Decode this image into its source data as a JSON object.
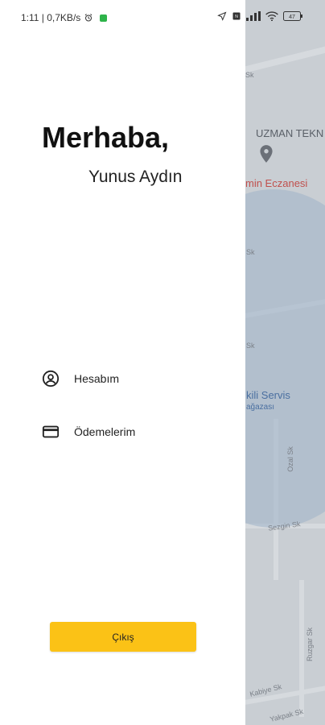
{
  "status_bar": {
    "time_speed": "1:11 | 0,7KB/s",
    "icons": [
      "alarm-icon",
      "location-arrow-icon",
      "nfc-icon",
      "signal-icon",
      "wifi-icon",
      "battery-icon"
    ],
    "battery": "47"
  },
  "drawer": {
    "greeting": "Merhaba,",
    "user_name": "Yunus Aydın",
    "menu": [
      {
        "label": "Hesabım",
        "icon": "account-circle-icon"
      },
      {
        "label": "Ödemelerim",
        "icon": "credit-card-icon"
      }
    ],
    "logout_label": "Çıkış"
  },
  "map": {
    "place_label": "UZMAN TEKN",
    "pharmacy_label": "min Eczanesi",
    "service_label": "kili Servis",
    "service_sub": "ağazası",
    "streets": [
      "Sk",
      "Sk",
      "Sk",
      "Sk",
      "Sk",
      "Sezgin Sk",
      "Ozal Sk",
      "Kabiye Sk",
      "Yakpak Sk",
      "Ruzgar Sk"
    ]
  },
  "colors": {
    "accent": "#fbc216",
    "map_overlay": "#c9ced3",
    "circle": "#9fb3c9"
  }
}
